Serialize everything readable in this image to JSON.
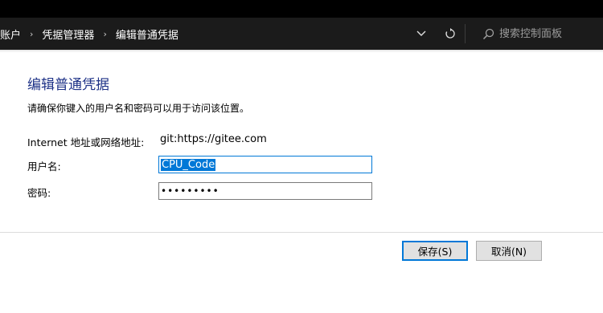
{
  "breadcrumb": {
    "items": [
      "账户",
      "凭据管理器",
      "编辑普通凭据"
    ],
    "separator": "›"
  },
  "addressbar": {
    "dropdown_icon": "chevron-down-icon",
    "refresh_icon": "refresh-icon"
  },
  "search": {
    "placeholder": "搜索控制面板",
    "icon": "search-icon"
  },
  "main": {
    "title": "编辑普通凭据",
    "instruction": "请确保你键入的用户名和密码可以用于访问该位置。",
    "address_label": "Internet 地址或网络地址:",
    "address_value": "git:https://gitee.com",
    "username_label": "用户名:",
    "username_value": "CPU_Code",
    "password_label": "密码:",
    "password_value": "•••••••••"
  },
  "buttons": {
    "save": "保存(S)",
    "cancel": "取消(N)"
  },
  "colors": {
    "title": "#1e3287",
    "selection": "#0078d7",
    "addressbar_bg": "#1b1b1b"
  }
}
